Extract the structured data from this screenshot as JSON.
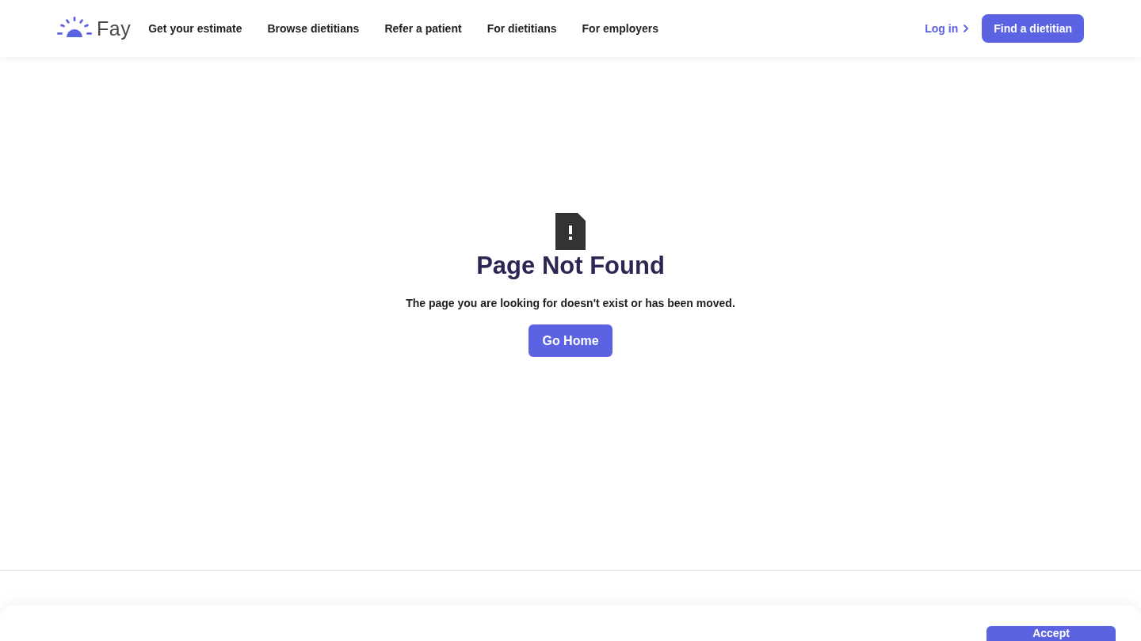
{
  "header": {
    "logo": {
      "text": "Fay"
    },
    "nav": [
      "Get your estimate",
      "Browse dietitians",
      "Refer a patient",
      "For dietitians",
      "For employers"
    ],
    "login": "Log in",
    "cta": "Find a dietitian"
  },
  "error": {
    "title": "Page Not Found",
    "message": "The page you are looking for doesn't exist or has been moved.",
    "button": "Go Home"
  },
  "cookie_banner": {
    "button": "Accept"
  }
}
